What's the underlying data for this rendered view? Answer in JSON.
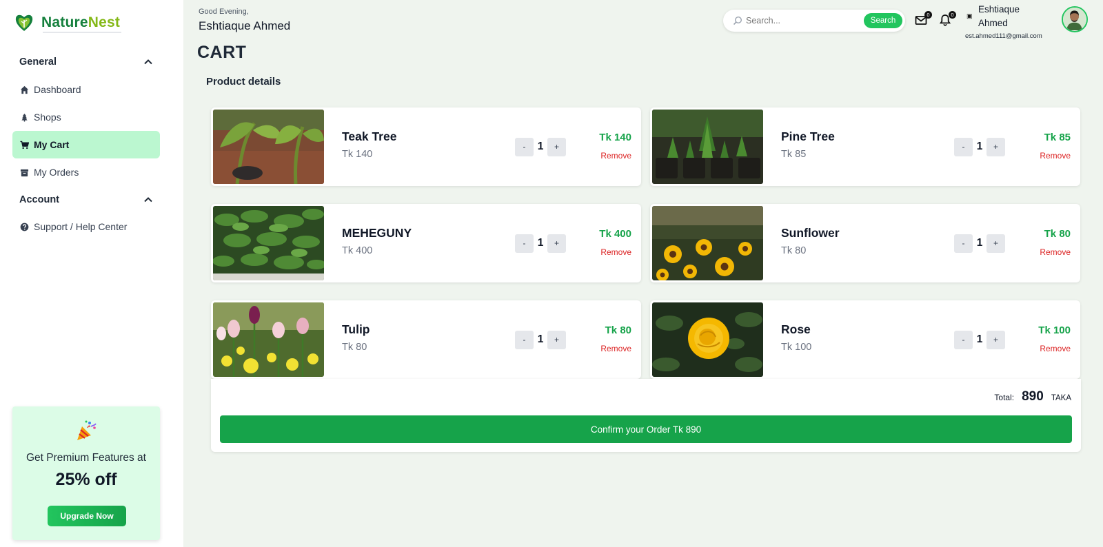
{
  "brand": {
    "name_part1": "Nature",
    "name_part2": "Nest"
  },
  "sidebar": {
    "sections": [
      {
        "label": "General",
        "icon": "chevron-up-icon"
      },
      {
        "label": "Account",
        "icon": "chevron-up-icon"
      }
    ],
    "items": [
      {
        "label": "Dashboard",
        "icon": "home-icon"
      },
      {
        "label": "Shops",
        "icon": "tree-icon"
      },
      {
        "label": "My Cart",
        "icon": "cart-icon",
        "active": true
      },
      {
        "label": "My Orders",
        "icon": "box-icon"
      },
      {
        "label": "Support / Help Center",
        "icon": "help-icon"
      }
    ],
    "promo": {
      "emoji": "party-popper-icon",
      "line1": "Get Premium Features at",
      "line2": "25% off",
      "button": "Upgrade Now"
    }
  },
  "header": {
    "greeting": "Good Evening,",
    "user_name": "Eshtiaque Ahmed",
    "search": {
      "placeholder": "Search...",
      "button": "Search"
    },
    "messages_badge": "0",
    "notifications_badge": "0",
    "profile": {
      "name": "Eshtiaque Ahmed",
      "email": "est.ahmed111@gmail.com"
    }
  },
  "page": {
    "title": "CART",
    "section_title": "Product details"
  },
  "cart": {
    "items": [
      {
        "name": "Teak Tree",
        "price": "Tk 140",
        "qty": "1",
        "total": "Tk 140",
        "remove": "Remove",
        "minus": "-",
        "plus": "+"
      },
      {
        "name": "Pine Tree",
        "price": "Tk 85",
        "qty": "1",
        "total": "Tk 85",
        "remove": "Remove",
        "minus": "-",
        "plus": "+"
      },
      {
        "name": "MEHEGUNY",
        "price": "Tk 400",
        "qty": "1",
        "total": "Tk 400",
        "remove": "Remove",
        "minus": "-",
        "plus": "+"
      },
      {
        "name": "Sunflower",
        "price": "Tk 80",
        "qty": "1",
        "total": "Tk 80",
        "remove": "Remove",
        "minus": "-",
        "plus": "+"
      },
      {
        "name": "Tulip",
        "price": "Tk 80",
        "qty": "1",
        "total": "Tk 80",
        "remove": "Remove",
        "minus": "-",
        "plus": "+"
      },
      {
        "name": "Rose",
        "price": "Tk 100",
        "qty": "1",
        "total": "Tk 100",
        "remove": "Remove",
        "minus": "-",
        "plus": "+"
      }
    ],
    "total_label": "Total:",
    "total_amount": "890",
    "total_unit": "TAKA",
    "confirm_button": "Confirm your Order Tk 890"
  },
  "colors": {
    "accent": "#16a34a",
    "active_nav": "#bbf7d0",
    "remove": "#dc2626",
    "background": "#eff4ee"
  }
}
